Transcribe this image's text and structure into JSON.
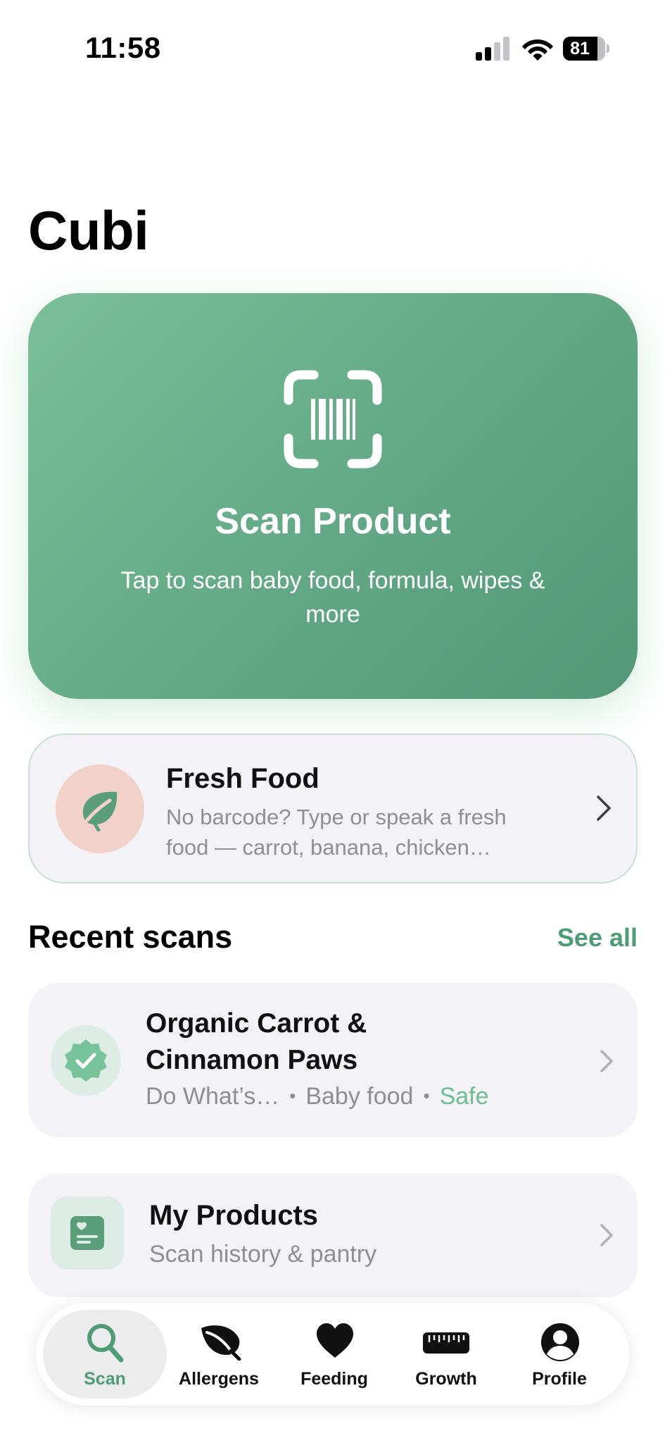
{
  "status_bar": {
    "time": "11:58",
    "battery_level": "81",
    "battery_fraction": 0.81,
    "icons": [
      "cellular-signal-icon",
      "wifi-icon",
      "battery-icon"
    ]
  },
  "page": {
    "title": "Cubi"
  },
  "scan_card": {
    "icon": "barcode-scan-icon",
    "title": "Scan Product",
    "subtitle": "Tap to scan baby food, formula, wipes & more"
  },
  "fresh_food": {
    "icon": "leaf-icon",
    "title": "Fresh Food",
    "subtitle": "No barcode? Type or speak a fresh food — carrot, banana, chicken…"
  },
  "recent_scans": {
    "title": "Recent scans",
    "see_all_label": "See all",
    "items": [
      {
        "icon": "verified-check-badge-icon",
        "name": "Organic Carrot & Cinnamon Paws",
        "brand": "Do What’s…",
        "category": "Baby food",
        "status": "Safe"
      }
    ]
  },
  "my_products": {
    "icon": "pantry-list-icon",
    "title": "My Products",
    "subtitle": "Scan history & pantry"
  },
  "tab_bar": {
    "active": "Scan",
    "tabs": [
      {
        "label": "Scan",
        "icon": "search-icon"
      },
      {
        "label": "Allergens",
        "icon": "leaf-icon"
      },
      {
        "label": "Feeding",
        "icon": "heart-icon"
      },
      {
        "label": "Growth",
        "icon": "ruler-icon"
      },
      {
        "label": "Profile",
        "icon": "person-circle-icon"
      }
    ]
  },
  "colors": {
    "accent_green": "#4e9c76",
    "scan_card_gradient_start": "#7cbf98",
    "scan_card_gradient_end": "#529878",
    "safe_green": "#6dbf92",
    "card_background": "#f2f2f7",
    "fresh_icon_background": "#f2d2c8",
    "secondary_text": "#8e8e93"
  }
}
